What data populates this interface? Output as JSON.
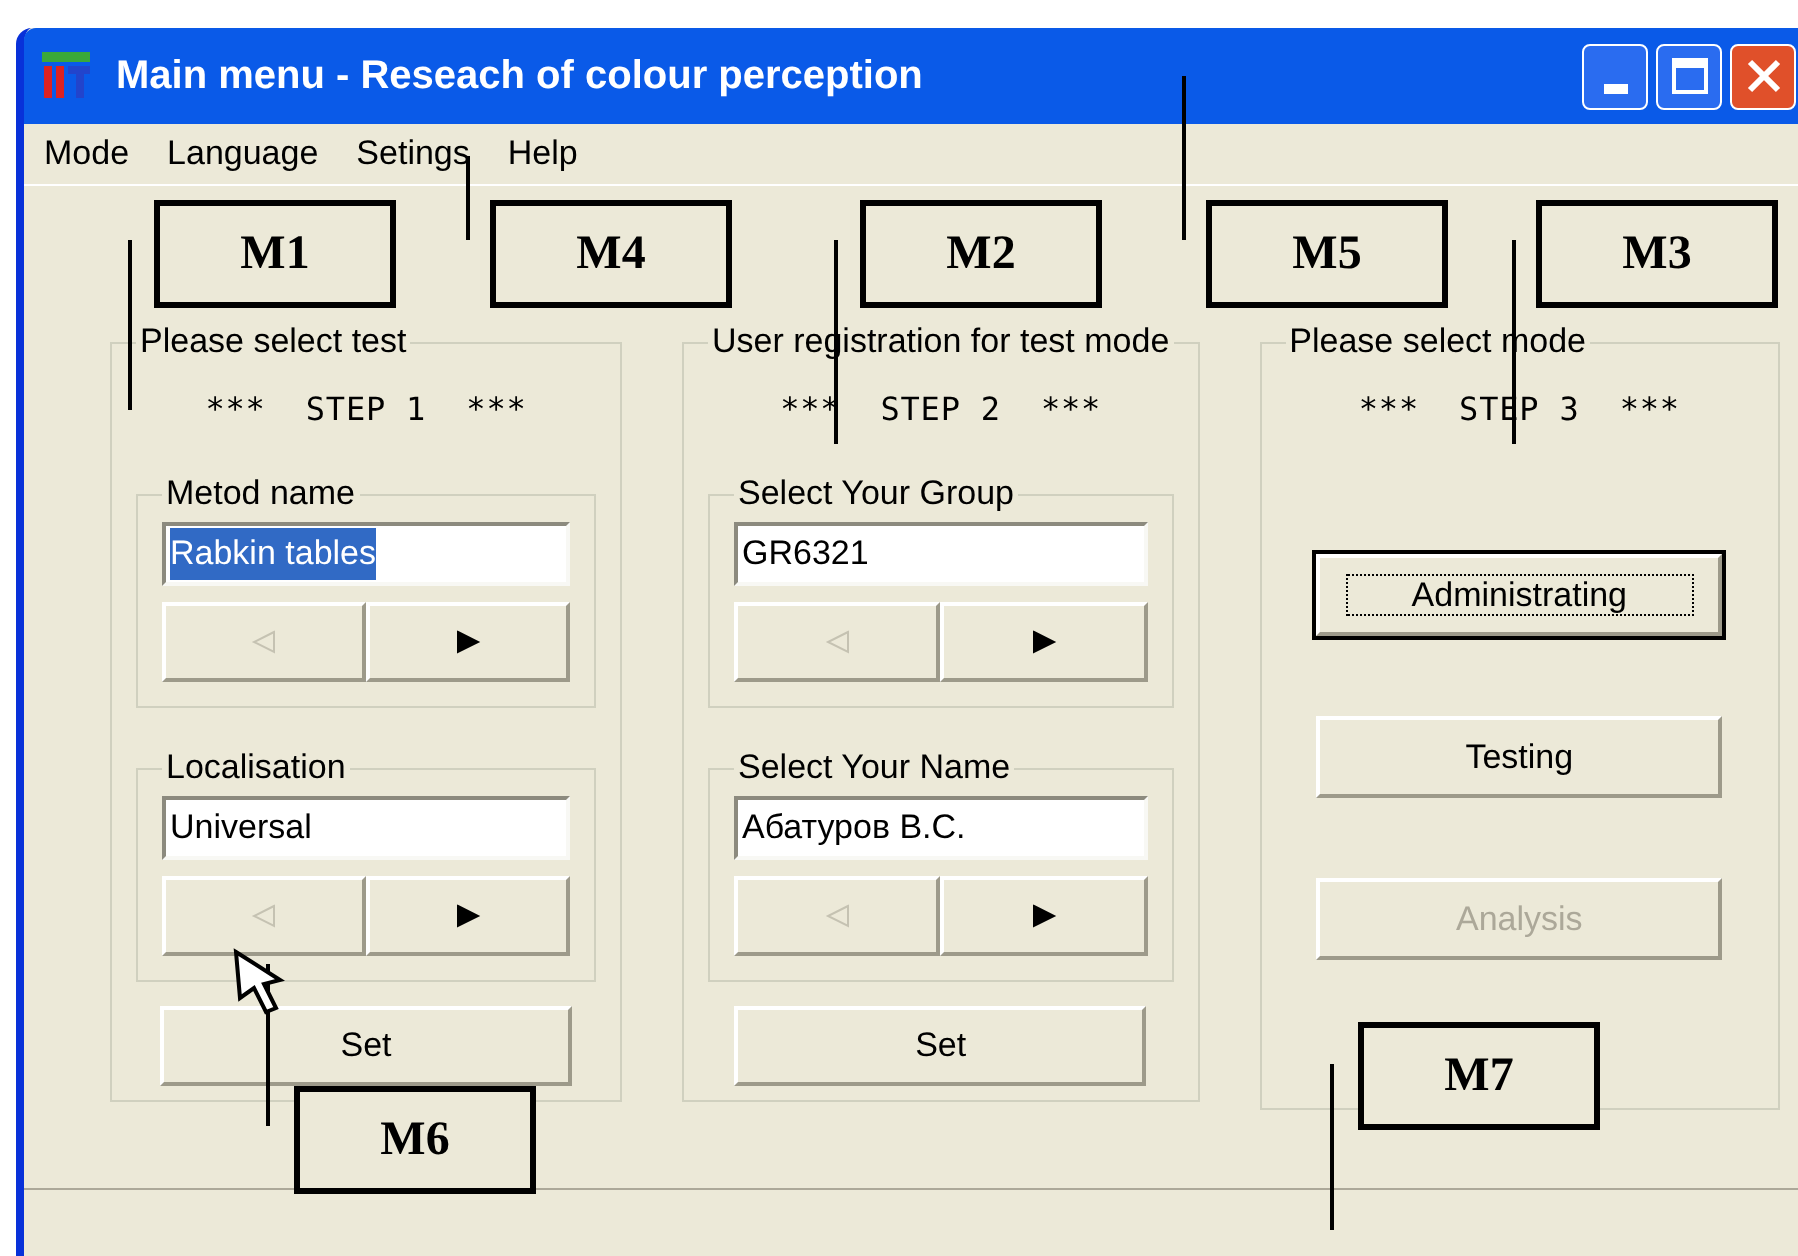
{
  "window": {
    "title": "Main menu - Reseach of colour perception"
  },
  "menu": [
    "Mode",
    "Language",
    "Setings",
    "Help"
  ],
  "panels": [
    {
      "title": "Please select test",
      "step": "***  STEP 1  ***",
      "groups": [
        {
          "label": "Metod name",
          "value": "Rabkin tables",
          "highlighted": true,
          "prev_disabled": true,
          "next_disabled": false
        },
        {
          "label": "Localisation",
          "value": "Universal",
          "highlighted": false,
          "prev_disabled": true,
          "next_disabled": false
        }
      ],
      "set_button": "Set"
    },
    {
      "title": "User registration for test mode",
      "step": "***  STEP 2  ***",
      "groups": [
        {
          "label": "Select Your Group",
          "value": "GR6321",
          "highlighted": false,
          "prev_disabled": true,
          "next_disabled": false
        },
        {
          "label": "Select Your Name",
          "value": "Абатуров В.С.",
          "highlighted": false,
          "prev_disabled": true,
          "next_disabled": false
        }
      ],
      "set_button": "Set"
    }
  ],
  "mode_panel": {
    "title": "Please select mode",
    "step": "***  STEP 3  ***",
    "buttons": [
      {
        "label": "Administrating",
        "focused": true,
        "disabled": false
      },
      {
        "label": "Testing",
        "focused": false,
        "disabled": false
      },
      {
        "label": "Analysis",
        "focused": false,
        "disabled": true
      }
    ]
  },
  "annotations": [
    "M1",
    "M4",
    "M2",
    "M5",
    "M3",
    "M6",
    "M7"
  ]
}
